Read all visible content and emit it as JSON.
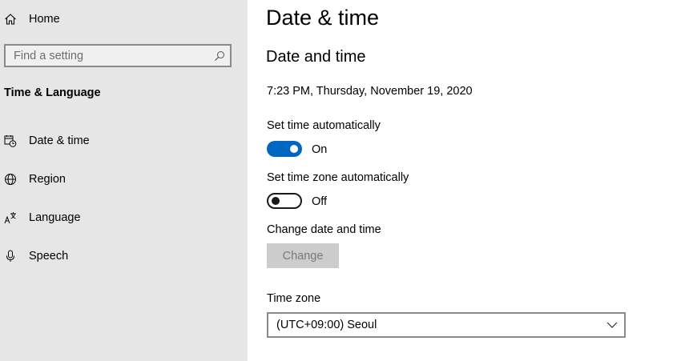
{
  "sidebar": {
    "home_label": "Home",
    "search_placeholder": "Find a setting",
    "section_title": "Time & Language",
    "items": [
      {
        "label": "Date & time",
        "icon": "calendar-clock-icon"
      },
      {
        "label": "Region",
        "icon": "globe-icon"
      },
      {
        "label": "Language",
        "icon": "language-icon"
      },
      {
        "label": "Speech",
        "icon": "microphone-icon"
      }
    ]
  },
  "main": {
    "page_title": "Date & time",
    "section_title": "Date and time",
    "current_datetime": "7:23 PM, Thursday, November 19, 2020",
    "set_time_auto": {
      "label": "Set time automatically",
      "state": "On"
    },
    "set_timezone_auto": {
      "label": "Set time zone automatically",
      "state": "Off"
    },
    "change_datetime": {
      "label": "Change date and time",
      "button": "Change"
    },
    "time_zone": {
      "label": "Time zone",
      "value": "(UTC+09:00) Seoul"
    }
  },
  "colors": {
    "accent": "#0067c0",
    "sidebar_bg": "#e6e6e6"
  }
}
